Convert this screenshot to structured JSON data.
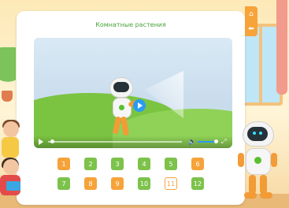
{
  "page": {
    "title": "Комнатные растения"
  },
  "video": {
    "progress": 0.03,
    "volume": 1.0
  },
  "lessons": [
    {
      "label": "1",
      "color": "orange"
    },
    {
      "label": "2",
      "color": "green"
    },
    {
      "label": "3",
      "color": "green"
    },
    {
      "label": "4",
      "color": "green"
    },
    {
      "label": "5",
      "color": "green"
    },
    {
      "label": "6",
      "color": "orange"
    },
    {
      "label": "7",
      "color": "green"
    },
    {
      "label": "8",
      "color": "orange"
    },
    {
      "label": "9",
      "color": "orange"
    },
    {
      "label": "10",
      "color": "green"
    },
    {
      "label": "11",
      "color": "current"
    },
    {
      "label": "12",
      "color": "green"
    }
  ],
  "toolbar": {
    "home_icon": "home-icon",
    "back_icon": "back-arrow-icon"
  },
  "colors": {
    "accent_orange": "#f6a33a",
    "accent_green": "#7dc24b",
    "title_green": "#4aa23c",
    "play_blue": "#2b9af3"
  }
}
